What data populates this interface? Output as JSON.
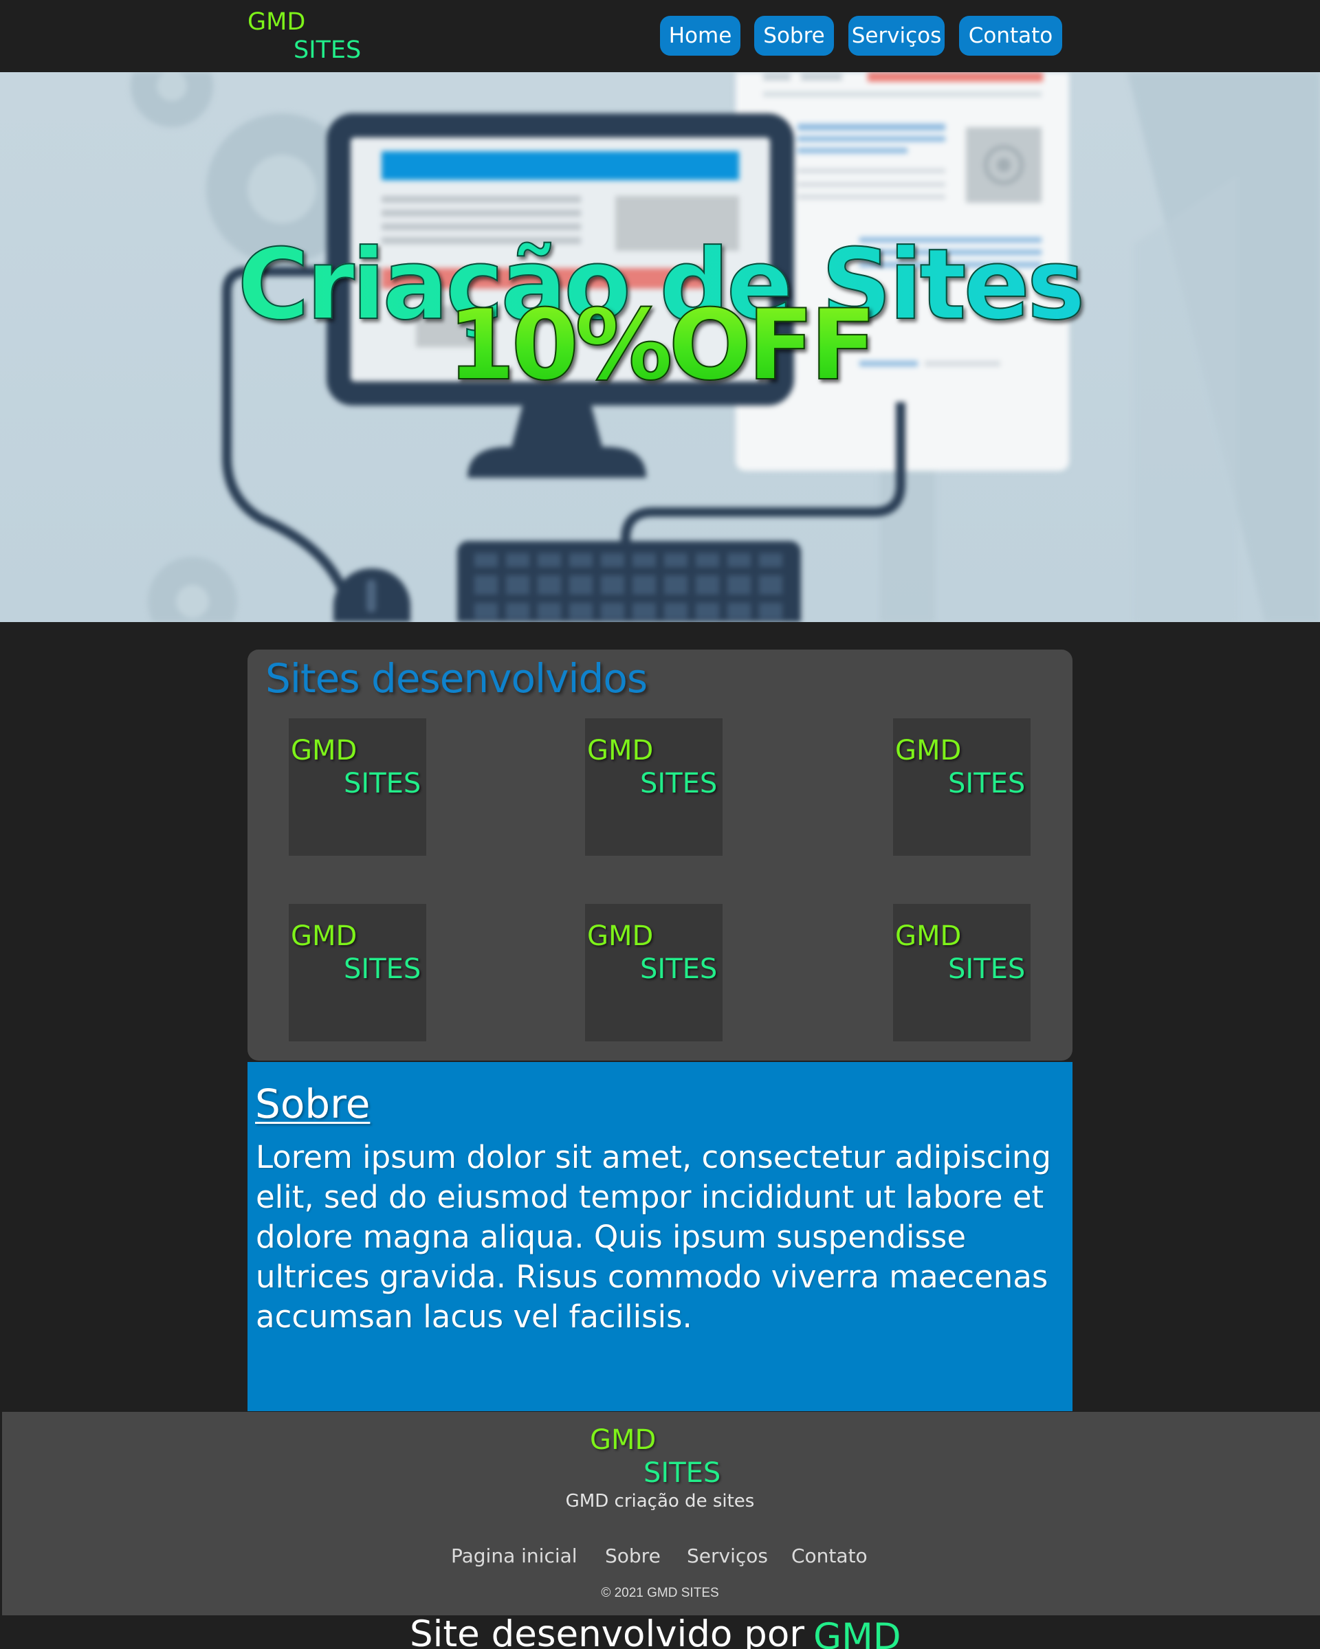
{
  "header": {
    "logo": {
      "line1": "GMD",
      "line2": "SITES"
    },
    "nav": [
      {
        "label": "Home"
      },
      {
        "label": "Sobre"
      },
      {
        "label": "Serviços"
      },
      {
        "label": "Contato"
      }
    ]
  },
  "hero": {
    "title": "Criação de Sites",
    "subtitle": "10%OFF"
  },
  "projects": {
    "title": "Sites desenvolvidos",
    "items": [
      {
        "line1": "GMD",
        "line2": "SITES"
      },
      {
        "line1": "GMD",
        "line2": "SITES"
      },
      {
        "line1": "GMD",
        "line2": "SITES"
      },
      {
        "line1": "GMD",
        "line2": "SITES"
      },
      {
        "line1": "GMD",
        "line2": "SITES"
      },
      {
        "line1": "GMD",
        "line2": "SITES"
      }
    ]
  },
  "about": {
    "title": "Sobre",
    "text": "Lorem ipsum dolor sit amet, consectetur adipiscing elit, sed do eiusmod tempor incididunt ut labore et dolore magna aliqua. Quis ipsum suspendisse ultrices gravida. Risus commodo viverra maecenas accumsan lacus vel facilisis."
  },
  "footer": {
    "logo": {
      "line1": "GMD",
      "line2": "SITES"
    },
    "tagline": "GMD criação de sites",
    "links": [
      {
        "label": "Pagina inicial"
      },
      {
        "label": "Sobre"
      },
      {
        "label": "Serviços"
      },
      {
        "label": "Contato"
      }
    ],
    "copyright": "© 2021 GMD SITES"
  },
  "credit": {
    "text": "Site desenvolvido por",
    "brand": "GMD"
  },
  "colors": {
    "accent_blue": "#0a7fcb",
    "logo_green": "#7ef31a",
    "logo_teal": "#22ee8a",
    "background": "#202020",
    "panel": "#484848"
  }
}
